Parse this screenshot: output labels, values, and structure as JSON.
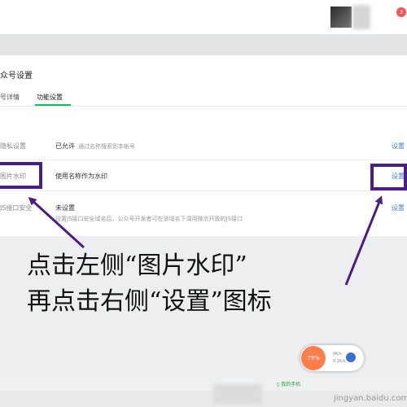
{
  "header": {
    "notification_count": "3"
  },
  "page_title": "众号设置",
  "tabs": [
    {
      "label": "号详情"
    },
    {
      "label": "功能设置"
    }
  ],
  "rows": [
    {
      "label": "隐私设置",
      "status": "已允许",
      "description": "通过名称搜索到本帐号",
      "action": "设置"
    },
    {
      "label": "图片水印",
      "status": "",
      "description": "使用名称作为水印",
      "action": "设置"
    },
    {
      "label": "JS接口安全",
      "status": "未设置",
      "description": "设置JS接口安全域名后，公众号开发者可在该域名下调用微信开放的JS接口",
      "action": "设置"
    }
  ],
  "annotation": {
    "line1": "点击左侧“图片水印”",
    "line2": "再点击右侧“设置”图标"
  },
  "widget": {
    "percent": "79%",
    "up_speed": "0K/s",
    "down_speed": "0.2K/s"
  },
  "taskbar": {
    "phone_label": "我的手机"
  },
  "watermark": "jingyan.baidu.com",
  "colors": {
    "annotation_box": "#4b1d87",
    "accent": "#07c160",
    "link": "#3f7fd0"
  }
}
